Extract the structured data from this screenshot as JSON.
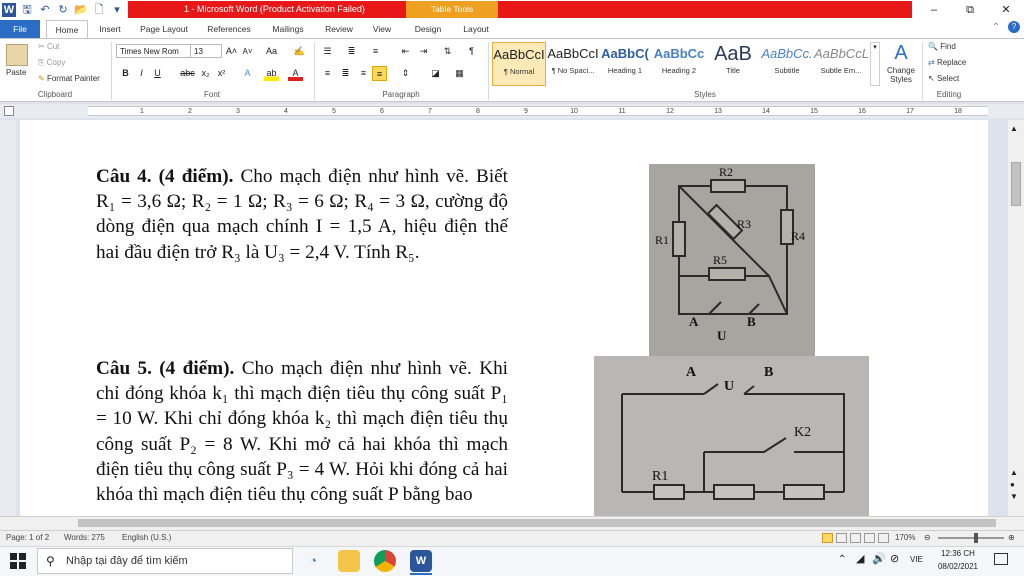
{
  "window": {
    "title": "1 - Microsoft Word (Product Activation Failed)",
    "context_tab": "Table Tools"
  },
  "tabs": [
    "File",
    "Home",
    "Insert",
    "Page Layout",
    "References",
    "Mailings",
    "Review",
    "View",
    "Design",
    "Layout"
  ],
  "clipboard": {
    "paste": "Paste",
    "cut": "Cut",
    "copy": "Copy",
    "format_painter": "Format Painter",
    "group": "Clipboard"
  },
  "font": {
    "name": "Times New Rom",
    "size": "13",
    "group": "Font"
  },
  "paragraph": {
    "group": "Paragraph"
  },
  "styles": {
    "group": "Styles",
    "items": [
      {
        "preview": "AaBbCcI",
        "name": "¶ Normal"
      },
      {
        "preview": "AaBbCcI",
        "name": "¶ No Spaci..."
      },
      {
        "preview": "AaBbC(",
        "name": "Heading 1"
      },
      {
        "preview": "AaBbCc",
        "name": "Heading 2"
      },
      {
        "preview": "AaB",
        "name": "Title"
      },
      {
        "preview": "AaBbCc.",
        "name": "Subtitle"
      },
      {
        "preview": "AaBbCcL",
        "name": "Subtle Em..."
      }
    ],
    "change": "Change Styles"
  },
  "editing": {
    "group": "Editing",
    "find": "Find",
    "replace": "Replace",
    "select": "Select"
  },
  "ruler": [
    "1",
    "2",
    "3",
    "4",
    "5",
    "6",
    "7",
    "8",
    "9",
    "10",
    "11",
    "12",
    "13",
    "14",
    "15",
    "16",
    "17",
    "18"
  ],
  "doc": {
    "q4_title": "Câu 4. (4 điểm).",
    "q4_body": "Cho mạch điện như hình vẽ. Biết R₁ = 3,6 Ω; R₂ = 1 Ω; R₃ = 6 Ω; R₄ = 3 Ω, cường độ dòng điện qua mạch chính I = 1,5 A, hiệu điện thế hai đầu điện trở R₃ là U₃ = 2,4 V. Tính R₅.",
    "q5_title": "Câu 5. (4 điểm).",
    "q5_body": "Cho mạch điện như hình vẽ. Khi chỉ đóng khóa k₁ thì mạch điện tiêu thụ công suất P₁ = 10 W. Khi chỉ đóng khóa k₂ thì mạch điện tiêu thụ công suất P₂ = 8 W. Khi mở cả hai khóa thì mạch điện tiêu thụ công suất P₃ = 4 W. Hỏi khi đóng cả hai khóa thì mạch điện tiêu thụ công suất P bằng bao",
    "fig1": {
      "r1": "R1",
      "r2": "R2",
      "r3": "R3",
      "r4": "R4",
      "r5": "R5",
      "a": "A",
      "b": "B",
      "u": "U"
    },
    "fig2": {
      "a": "A",
      "b": "B",
      "u": "U",
      "k2": "K2",
      "r1": "R1"
    }
  },
  "status": {
    "page": "Page: 1 of 2",
    "words": "Words: 275",
    "lang": "English (U.S.)",
    "zoom": "170%"
  },
  "taskbar": {
    "search_placeholder": "Nhập tại đây để tìm kiếm",
    "lang": "VIE",
    "time": "12:36 CH",
    "date": "08/02/2021"
  }
}
